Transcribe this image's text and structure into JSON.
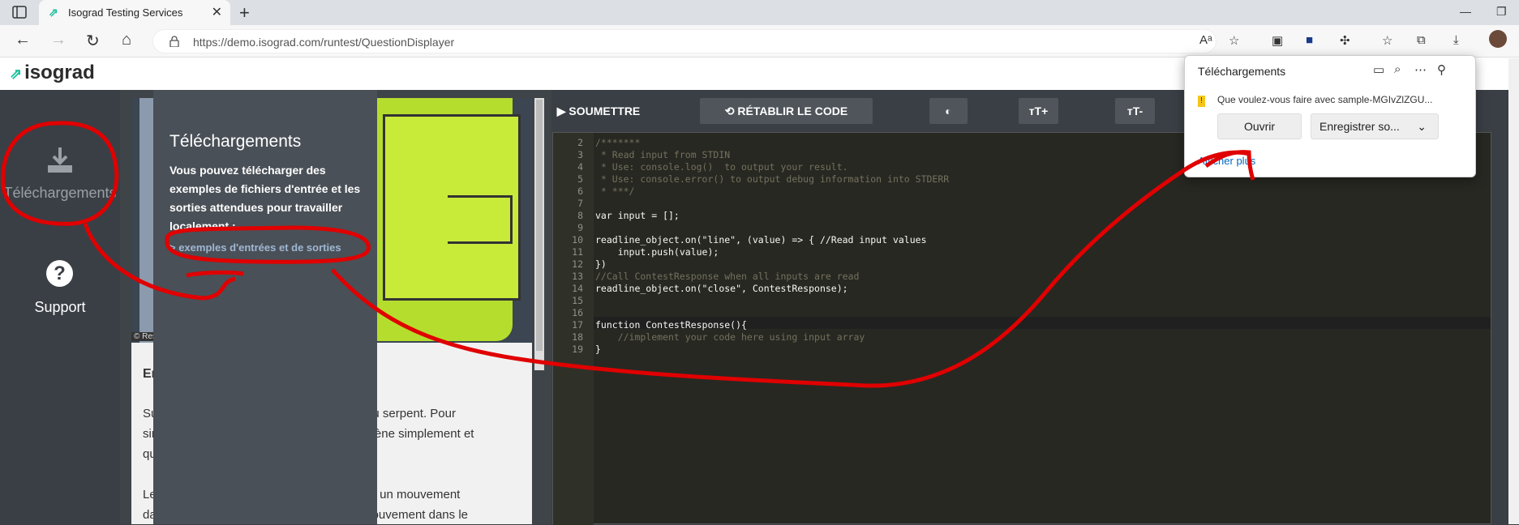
{
  "browser": {
    "tab_title": "Isograd Testing Services",
    "tab_close": "✕",
    "new_tab": "+",
    "url": "https://demo.isograd.com/runtest/QuestionDisplayer"
  },
  "header": {
    "logo_text": "isograd"
  },
  "sidebar": {
    "downloads_label": "Téléchargements",
    "support_label": "Support",
    "support_glyph": "?"
  },
  "popover": {
    "title": "Téléchargements",
    "description": "Vous pouvez télécharger des exemples de fichiers d'entrée et les sorties attendues pour travailler localement :",
    "link": "> exemples d'entrées et de sorties"
  },
  "article": {
    "heading": "En",
    "p1_line1": "Su                                                    le jeu du serpent. Pour",
    "p1_line2": "sim                                                  se promène simplement et",
    "p1_line3": "qu",
    "p2_line1": "Le                                                   re s'il fait un mouvement",
    "p2_line2": "da                                                   ès un mouvement dans le",
    "image_caption": "© Res"
  },
  "toolbar": {
    "submit_label": "▶ SOUMETTRE",
    "reset_label": "⟲ RÉTABLIR LE CODE ORIGINAL",
    "contrast_icon": "◐",
    "font_up_label": "ᴛT+",
    "font_down_label": "ᴛT-"
  },
  "editor": {
    "lines": [
      {
        "n": "2",
        "text": "/*******"
      },
      {
        "n": "3",
        "text": " * Read input from STDIN"
      },
      {
        "n": "4",
        "text": " * Use: console.log()  to output your result."
      },
      {
        "n": "5",
        "text": " * Use: console.error() to output debug information into STDERR"
      },
      {
        "n": "6",
        "text": " * ***/"
      },
      {
        "n": "7",
        "text": ""
      },
      {
        "n": "8",
        "text": "var input = [];"
      },
      {
        "n": "9",
        "text": ""
      },
      {
        "n": "10",
        "text": "readline_object.on(\"line\", (value) => { //Read input values"
      },
      {
        "n": "11",
        "text": "    input.push(value);"
      },
      {
        "n": "12",
        "text": "})"
      },
      {
        "n": "13",
        "text": "//Call ContestResponse when all inputs are read"
      },
      {
        "n": "14",
        "text": "readline_object.on(\"close\", ContestResponse);"
      },
      {
        "n": "15",
        "text": ""
      },
      {
        "n": "16",
        "text": ""
      },
      {
        "n": "17",
        "text": "function ContestResponse(){"
      },
      {
        "n": "18",
        "text": "    //implement your code here using input array"
      },
      {
        "n": "19",
        "text": "}"
      }
    ]
  },
  "downloads_panel": {
    "title": "Téléchargements",
    "file_prompt": "Que voulez-vous faire avec sample-MGIvZlZGU...",
    "open_label": "Ouvrir",
    "save_label": "Enregistrer so...",
    "more_label": "Afficher plus"
  },
  "colors": {
    "accent": "#1ac09a",
    "annotation": "#e00000",
    "editor_bg": "#272822"
  }
}
